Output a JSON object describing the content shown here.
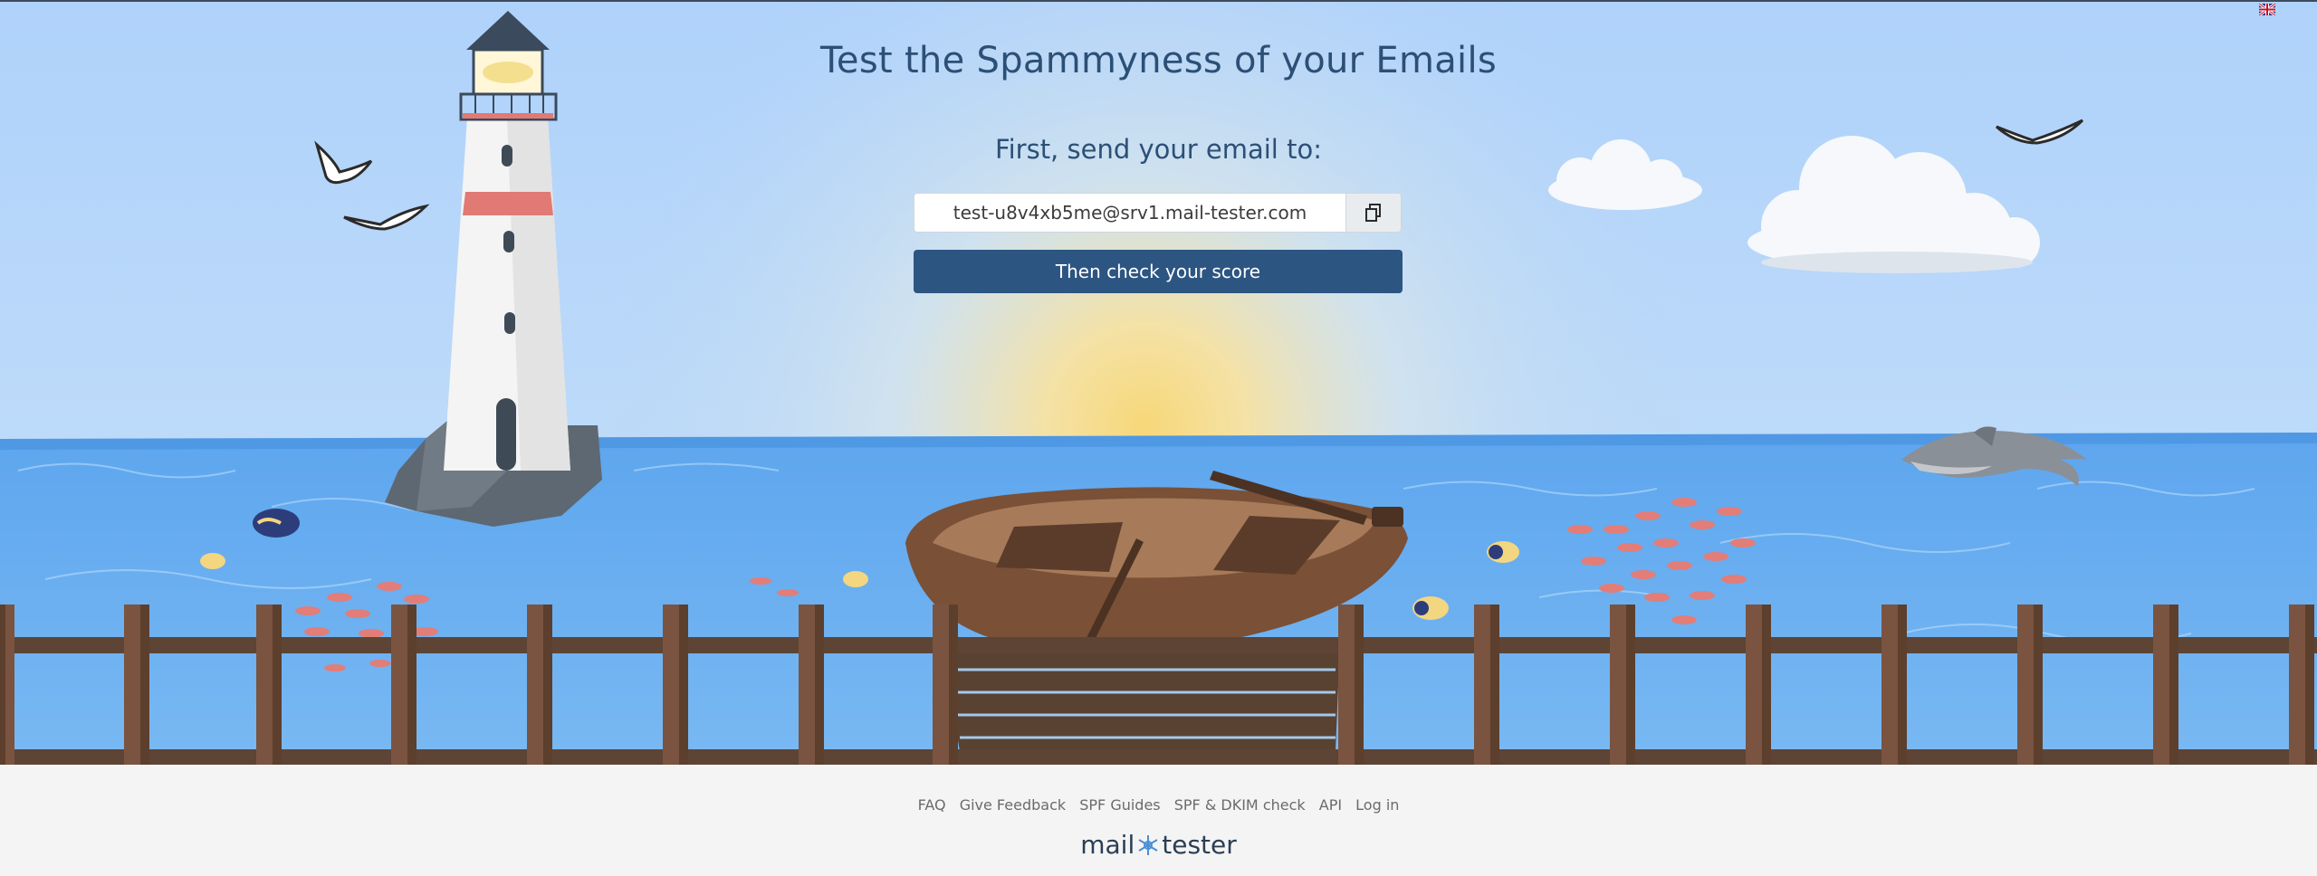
{
  "header": {
    "title": "Test the Spammyness of your Emails"
  },
  "form": {
    "instruction": "First, send your email to:",
    "email_address": "test-u8v4xb5me@srv1.mail-tester.com",
    "check_button_label": "Then check your score"
  },
  "footer": {
    "links": [
      "FAQ",
      "Give Feedback",
      "SPF Guides",
      "SPF & DKIM check",
      "API",
      "Log in"
    ],
    "logo": {
      "left": "mail",
      "right": "tester"
    }
  },
  "colors": {
    "title": "#2c4f76",
    "button": "#2c5582",
    "sky": "#b3d4f8",
    "sea": "#6faff0",
    "dock": "#6e4a36",
    "footer_bg": "#f4f4f4"
  },
  "icons": [
    "flag-icon",
    "copy-icon",
    "lighthouse",
    "boat",
    "dolphin",
    "seagull-icon",
    "cloud",
    "fish",
    "sun"
  ]
}
